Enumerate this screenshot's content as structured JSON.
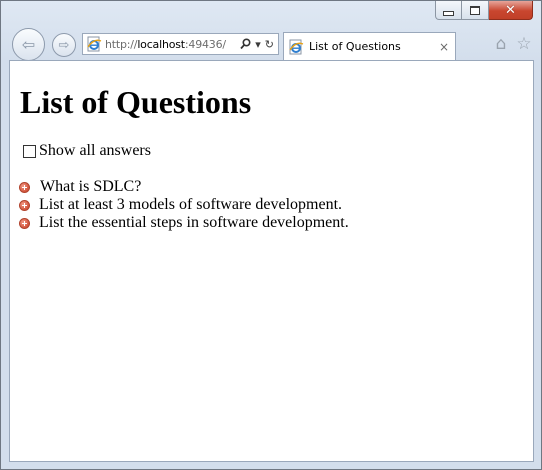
{
  "browser": {
    "address_bar": {
      "url_scheme": "http://",
      "url_host": "localhost",
      "url_port": ":49436/",
      "search_glyph": "⚲",
      "dropdown_glyph": "▾",
      "refresh_glyph": "↻",
      "icon": "ie-page-icon"
    },
    "tab": {
      "label": "List of Questions",
      "close_glyph": "×",
      "icon": "ie-page-icon"
    },
    "caption_buttons": {
      "close_glyph": "✕"
    },
    "nav": {
      "back_glyph": "⇦",
      "forward_glyph": "⇨"
    },
    "toolbar": {
      "home_glyph": "⌂",
      "favorites_glyph": "☆"
    }
  },
  "page": {
    "title": "List of Questions",
    "show_all_answers_label": "Show all answers",
    "show_all_answers_checked": false,
    "questions": [
      {
        "text": "What is SDLC?",
        "icon": "expand-plus-icon"
      },
      {
        "text": "List at least 3 models of software development.",
        "icon": "expand-plus-icon"
      },
      {
        "text": "List the essential steps in software development.",
        "icon": "expand-plus-icon"
      }
    ]
  },
  "colors": {
    "window_frame": "#d3deec",
    "close_button": "#c9462f",
    "expand_icon": "#d2543c"
  }
}
